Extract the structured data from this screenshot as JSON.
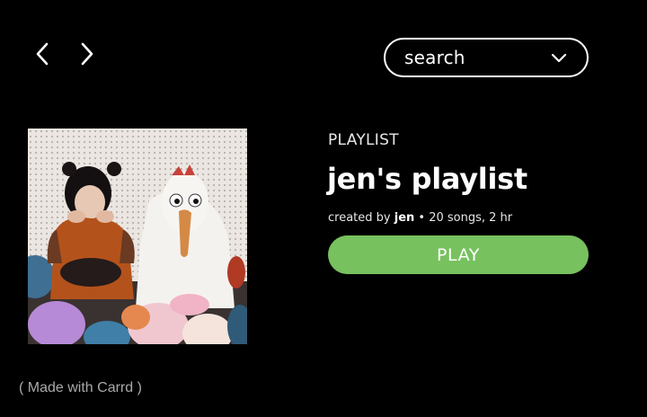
{
  "nav": {
    "back_icon": "chevron-left-icon",
    "forward_icon": "chevron-right-icon"
  },
  "search": {
    "label": "search",
    "icon": "chevron-down-icon"
  },
  "playlist": {
    "type_label": "PLAYLIST",
    "title": "jen's playlist",
    "created_by_prefix": "created by ",
    "owner": "jen",
    "details": " • 20 songs, 2 hr",
    "play_label": "PLAY",
    "cover_image": "album-cover-photo"
  },
  "footer": {
    "made_with": "( Made with Carrd )"
  },
  "colors": {
    "background": "#000000",
    "play_button": "#77c15f",
    "text": "#ffffff",
    "footer_text": "#a9a9a9"
  }
}
